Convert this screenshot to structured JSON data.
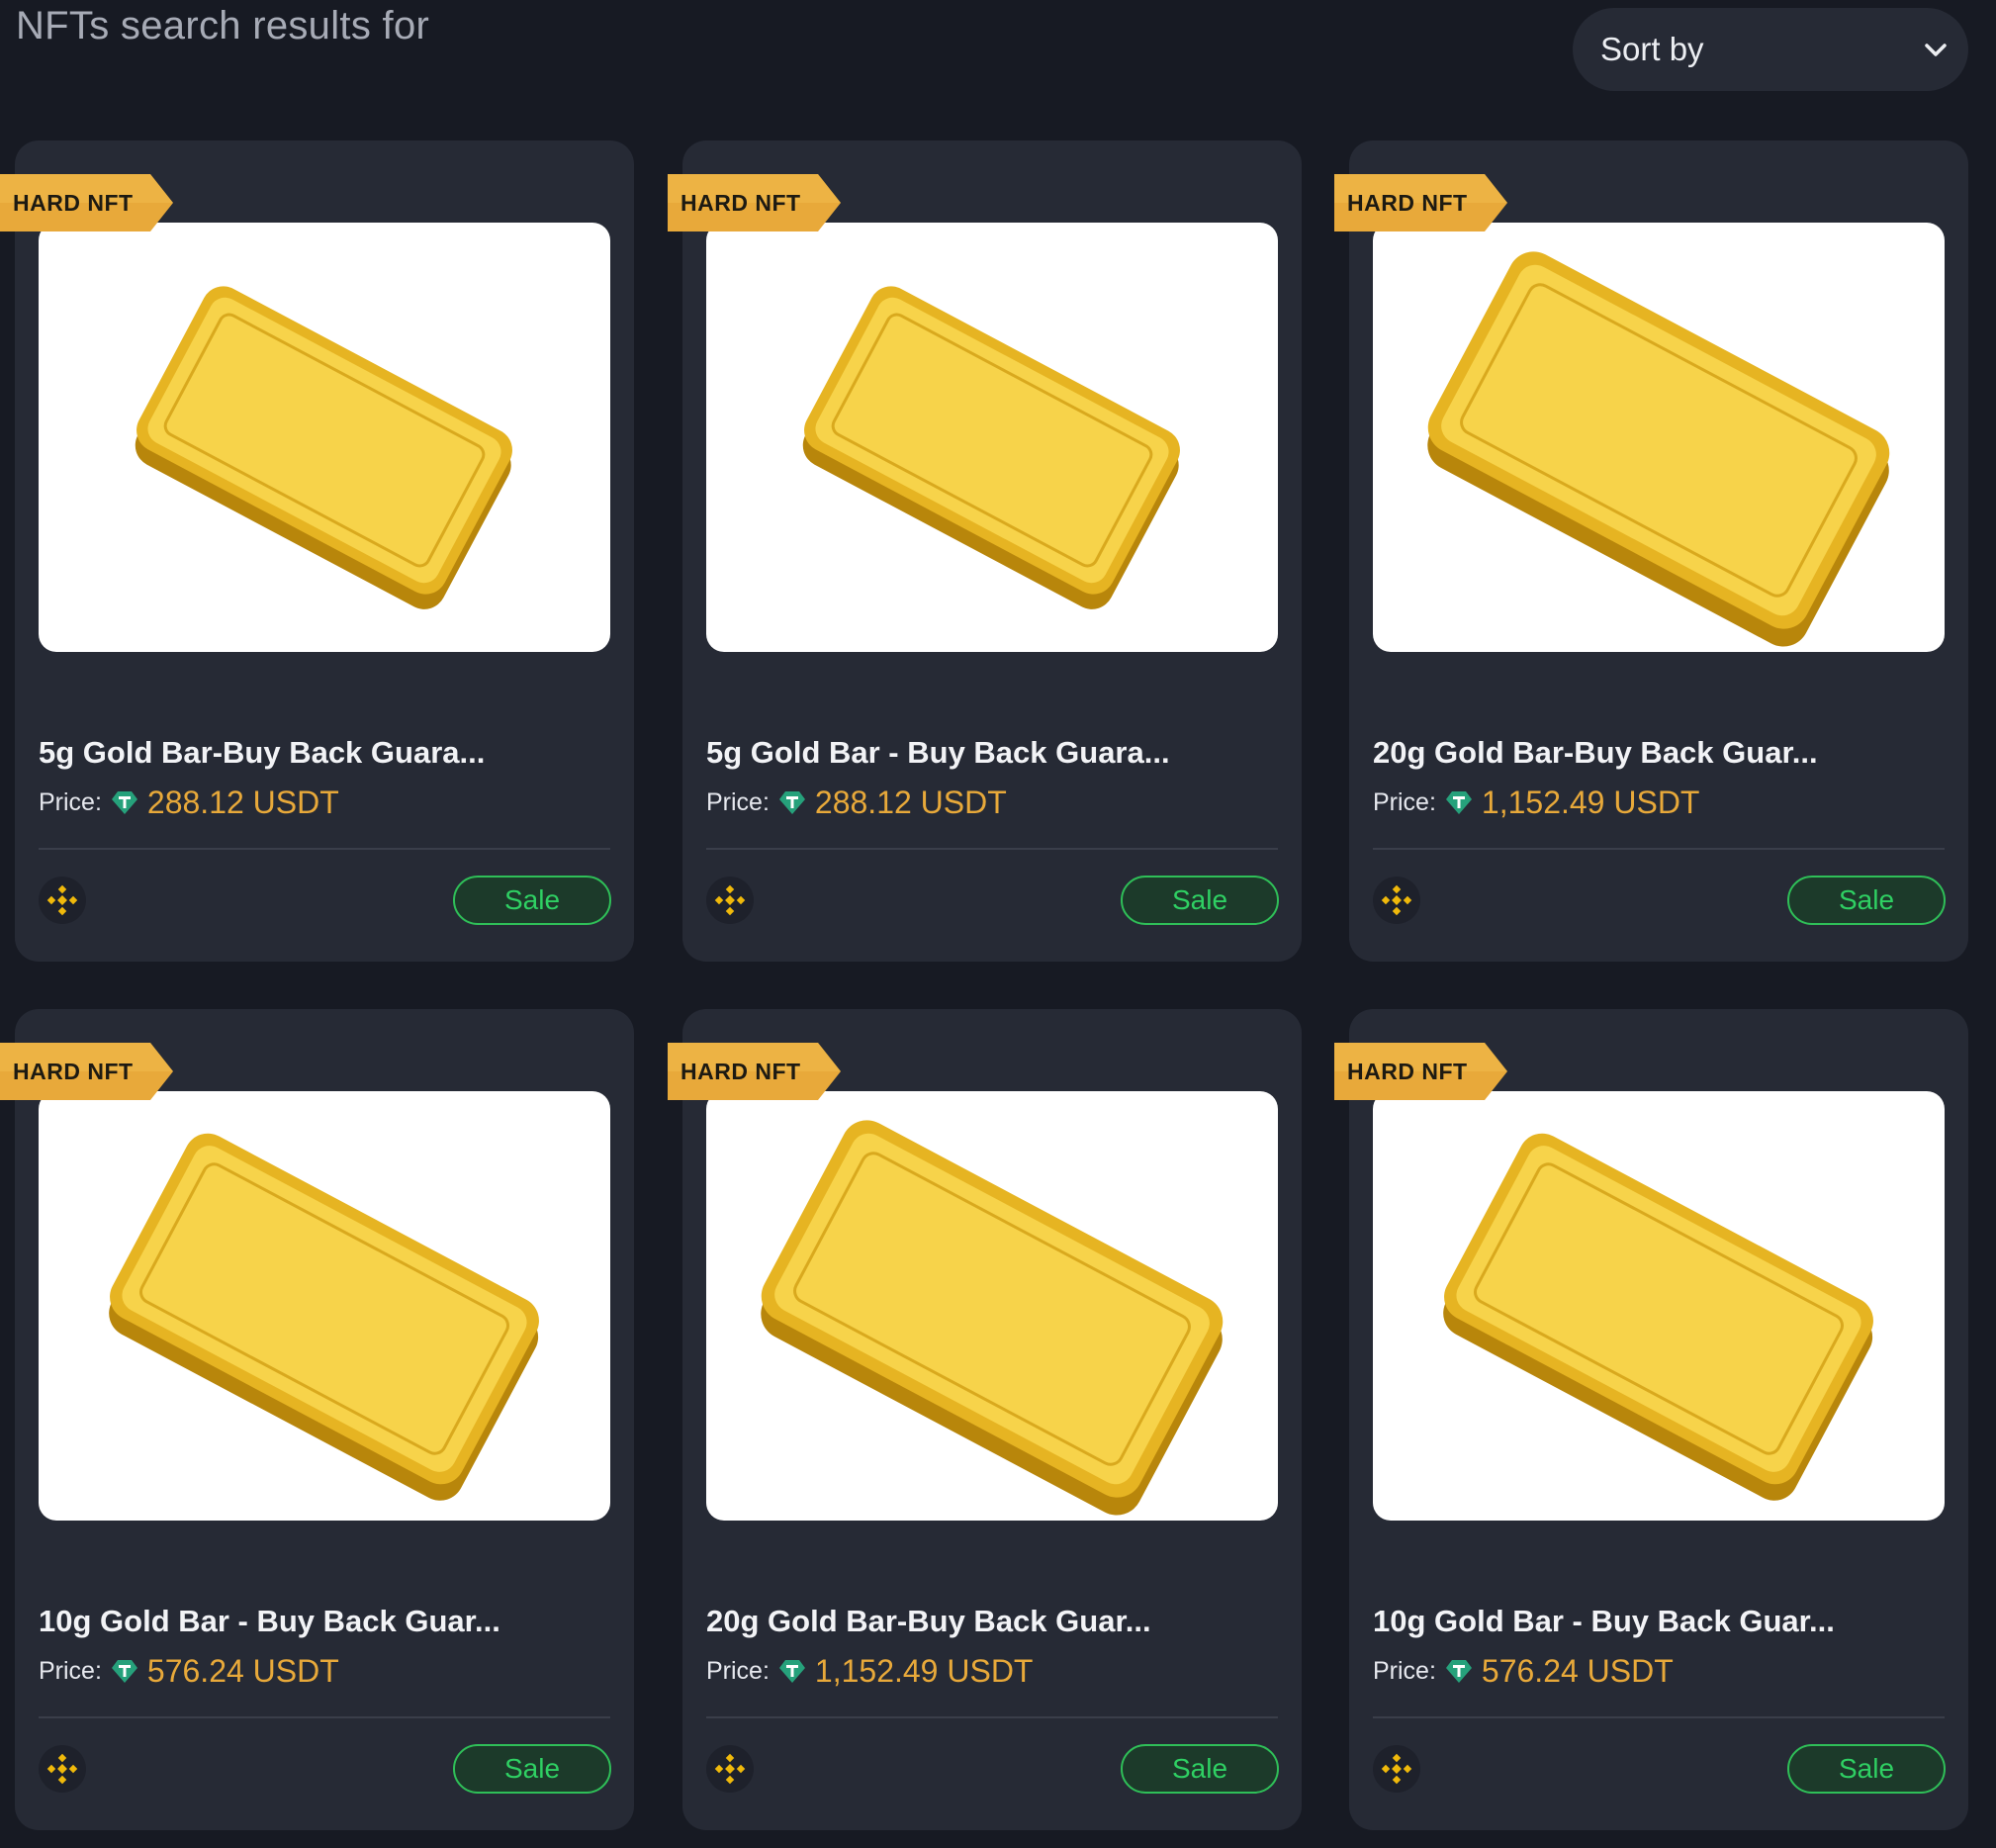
{
  "header": {
    "title": "NFTs search results for",
    "sort_label": "Sort by",
    "sort_icon": "chevron-down-icon"
  },
  "colors": {
    "background": "#171a23",
    "card": "#262a35",
    "badge_gold": "#e8a93a",
    "price": "#e8a93a",
    "sale_green": "#2fd063",
    "tether": "#26a17b",
    "chain_yellow": "#f0b90b"
  },
  "cards": [
    {
      "badge": "HARD NFT",
      "title": "5g Gold Bar-Buy Back Guara...",
      "price_label": "Price:",
      "price": "288.12 USDT",
      "price_icon": "tether-icon",
      "chain_icon": "bnb-chain-icon",
      "action": "Sale",
      "image_alt": "5g gold bar"
    },
    {
      "badge": "HARD NFT",
      "title": "5g Gold Bar - Buy Back Guara...",
      "price_label": "Price:",
      "price": "288.12 USDT",
      "price_icon": "tether-icon",
      "chain_icon": "bnb-chain-icon",
      "action": "Sale",
      "image_alt": "5g gold bar"
    },
    {
      "badge": "HARD NFT",
      "title": "20g Gold Bar-Buy Back Guar...",
      "price_label": "Price:",
      "price": "1,152.49 USDT",
      "price_icon": "tether-icon",
      "chain_icon": "bnb-chain-icon",
      "action": "Sale",
      "image_alt": "20g gold bar"
    },
    {
      "badge": "HARD NFT",
      "title": "10g Gold Bar - Buy Back Guar...",
      "price_label": "Price:",
      "price": "576.24 USDT",
      "price_icon": "tether-icon",
      "chain_icon": "bnb-chain-icon",
      "action": "Sale",
      "image_alt": "10g gold bar"
    },
    {
      "badge": "HARD NFT",
      "title": "20g Gold Bar-Buy Back Guar...",
      "price_label": "Price:",
      "price": "1,152.49 USDT",
      "price_icon": "tether-icon",
      "chain_icon": "bnb-chain-icon",
      "action": "Sale",
      "image_alt": "20g gold bar"
    },
    {
      "badge": "HARD NFT",
      "title": "10g Gold Bar - Buy Back Guar...",
      "price_label": "Price:",
      "price": "576.24 USDT",
      "price_icon": "tether-icon",
      "chain_icon": "bnb-chain-icon",
      "action": "Sale",
      "image_alt": "10g gold bar"
    }
  ]
}
